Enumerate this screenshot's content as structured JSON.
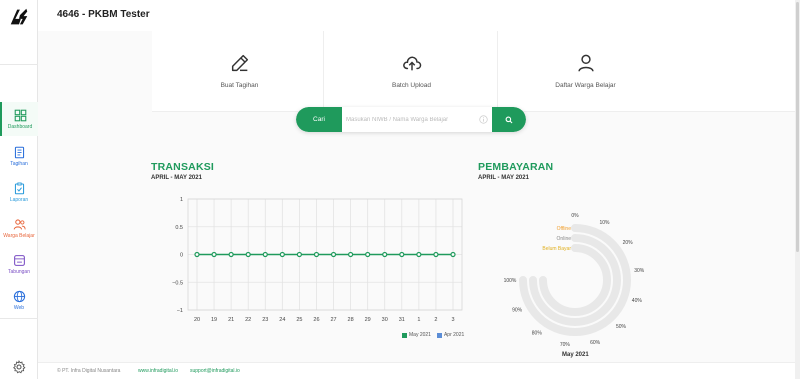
{
  "app": {
    "title": "4646 - PKBM Tester"
  },
  "sidebar": {
    "items": [
      {
        "label": "Dashboard",
        "color": "#1f9a5c"
      },
      {
        "label": "Tagihan",
        "color": "#2a6fdb"
      },
      {
        "label": "Laporan",
        "color": "#2a9bdb"
      },
      {
        "label": "Warga Belajar",
        "color": "#e8663c"
      },
      {
        "label": "Tabungan",
        "color": "#7b4fc4"
      },
      {
        "label": "Web",
        "color": "#2a6fdb"
      }
    ]
  },
  "actions": [
    {
      "label": "Buat Tagihan",
      "icon": "edit-icon"
    },
    {
      "label": "Batch Upload",
      "icon": "cloud-upload-icon"
    },
    {
      "label": "Daftar Warga Belajar",
      "icon": "user-icon"
    }
  ],
  "search": {
    "button_label": "Cari",
    "placeholder": "Masukan NIWB / Nama Warga Belajar"
  },
  "transaksi": {
    "title": "TRANSAKSI",
    "period": "APRIL - MAY 2021",
    "legend": [
      "May 2021",
      "Apr 2021"
    ]
  },
  "pembayaran": {
    "title": "PEMBAYARAN",
    "period": "APRIL - MAY 2021",
    "month_label": "May 2021",
    "ring_labels": [
      "Offline",
      "Online",
      "Belum Bayar"
    ]
  },
  "chart_data": [
    {
      "type": "line",
      "title": "TRANSAKSI",
      "x": [
        "20",
        "19",
        "21",
        "22",
        "23",
        "24",
        "25",
        "26",
        "27",
        "28",
        "29",
        "30",
        "31",
        "1",
        "2",
        "3"
      ],
      "series": [
        {
          "name": "May 2021",
          "color": "#1f9a5c",
          "values": [
            0,
            0,
            0,
            0,
            0,
            0,
            0,
            0,
            0,
            0,
            0,
            0,
            0,
            0,
            0,
            0
          ]
        },
        {
          "name": "Apr 2021",
          "color": "#5b8dd6",
          "values": []
        }
      ],
      "yticks": [
        "1",
        "0.5",
        "0",
        "−0.5",
        "−1"
      ],
      "ylim": [
        -1,
        1
      ],
      "grid": true,
      "legend": "bottom-right"
    },
    {
      "type": "pie",
      "title": "PEMBAYARAN",
      "subtitle": "May 2021",
      "ticks": [
        "0%",
        "10%",
        "20%",
        "30%",
        "40%",
        "50%",
        "60%",
        "70%",
        "80%",
        "90%",
        "100%"
      ],
      "series": [
        {
          "name": "Offline",
          "color": "#f0a030",
          "values": [
            0
          ]
        },
        {
          "name": "Online",
          "color": "#888888",
          "values": [
            0
          ]
        },
        {
          "name": "Belum Bayar",
          "color": "#e0b020",
          "values": [
            0
          ]
        }
      ]
    }
  ],
  "footer": {
    "company": "© PT. Infra Digital Nusantara",
    "website": "www.infradigital.io",
    "email": "support@infradigital.io"
  }
}
